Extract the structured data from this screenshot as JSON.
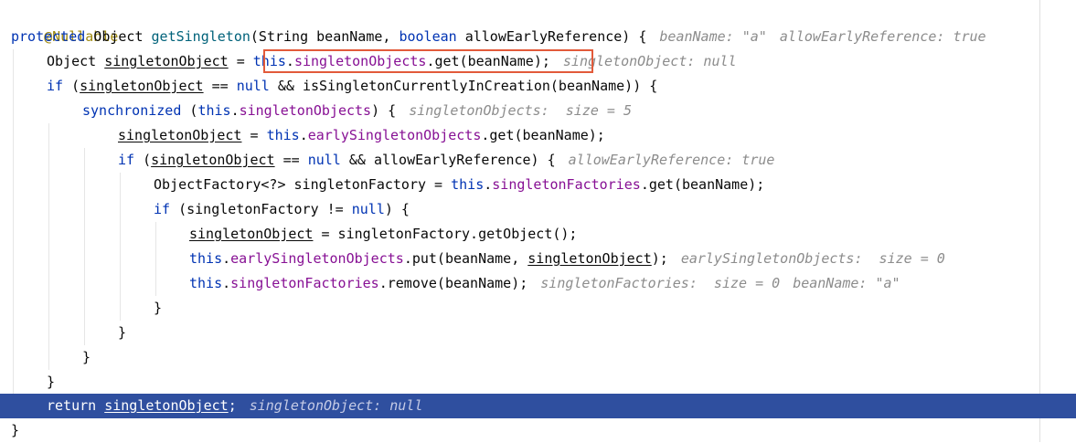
{
  "code": {
    "l1_annotation": "@Nullable",
    "l2_kw_protected": "protected",
    "l2_sig_a": " Object ",
    "l2_method": "getSingleton",
    "l2_sig_b": "(String beanName, ",
    "l2_kw_boolean": "boolean",
    "l2_sig_c": " allowEarlyReference) {",
    "l2_hint_1": "beanName: \"a\"",
    "l2_hint_2": "allowEarlyReference: true",
    "l3_type": "Object ",
    "l3_var": "singletonObject",
    "l3_eq": " = ",
    "l3_this": "this",
    "l3_dot": ".",
    "l3_field": "singletonObjects",
    "l3_call": ".get(beanName);",
    "l3_hint": "singletonObject: null",
    "l4_if": "if",
    "l4_open": " (",
    "l4_var": "singletonObject",
    "l4_eqeq": " == ",
    "l4_null": "null",
    "l4_rest": " && isSingletonCurrentlyInCreation(beanName)) {",
    "l5_sync": "synchronized",
    "l5_open": " (",
    "l5_this": "this",
    "l5_dot": ".",
    "l5_field": "singletonObjects",
    "l5_close": ") {",
    "l5_hint": "singletonObjects:  size = 5",
    "l6_var": "singletonObject",
    "l6_eq": " = ",
    "l6_this": "this",
    "l6_dot": ".",
    "l6_field": "earlySingletonObjects",
    "l6_call": ".get(beanName);",
    "l7_if": "if",
    "l7_open": " (",
    "l7_var": "singletonObject",
    "l7_eqeq": " == ",
    "l7_null": "null",
    "l7_rest": " && allowEarlyReference) {",
    "l7_hint": "allowEarlyReference: true",
    "l8_decl": "ObjectFactory<?> singletonFactory = ",
    "l8_this": "this",
    "l8_dot": ".",
    "l8_field": "singletonFactories",
    "l8_call": ".get(beanName);",
    "l9_if": "if",
    "l9_open": " (singletonFactory != ",
    "l9_null": "null",
    "l9_close": ") {",
    "l10_var": "singletonObject",
    "l10_rest": " = singletonFactory.getObject();",
    "l11_this": "this",
    "l11_dot": ".",
    "l11_field": "earlySingletonObjects",
    "l11_call": ".put(beanName, ",
    "l11_var": "singletonObject",
    "l11_close": ");",
    "l11_hint": "earlySingletonObjects:  size = 0",
    "l12_this": "this",
    "l12_dot": ".",
    "l12_field": "singletonFactories",
    "l12_call": ".remove(beanName);",
    "l12_hint_1": "singletonFactories:  size = 0",
    "l12_hint_2": "beanName: \"a\"",
    "brace": "}",
    "l17_return": "return",
    "l17_sp": " ",
    "l17_var": "singletonObject",
    "l17_semi": ";",
    "l17_hint": "singletonObject: null"
  }
}
